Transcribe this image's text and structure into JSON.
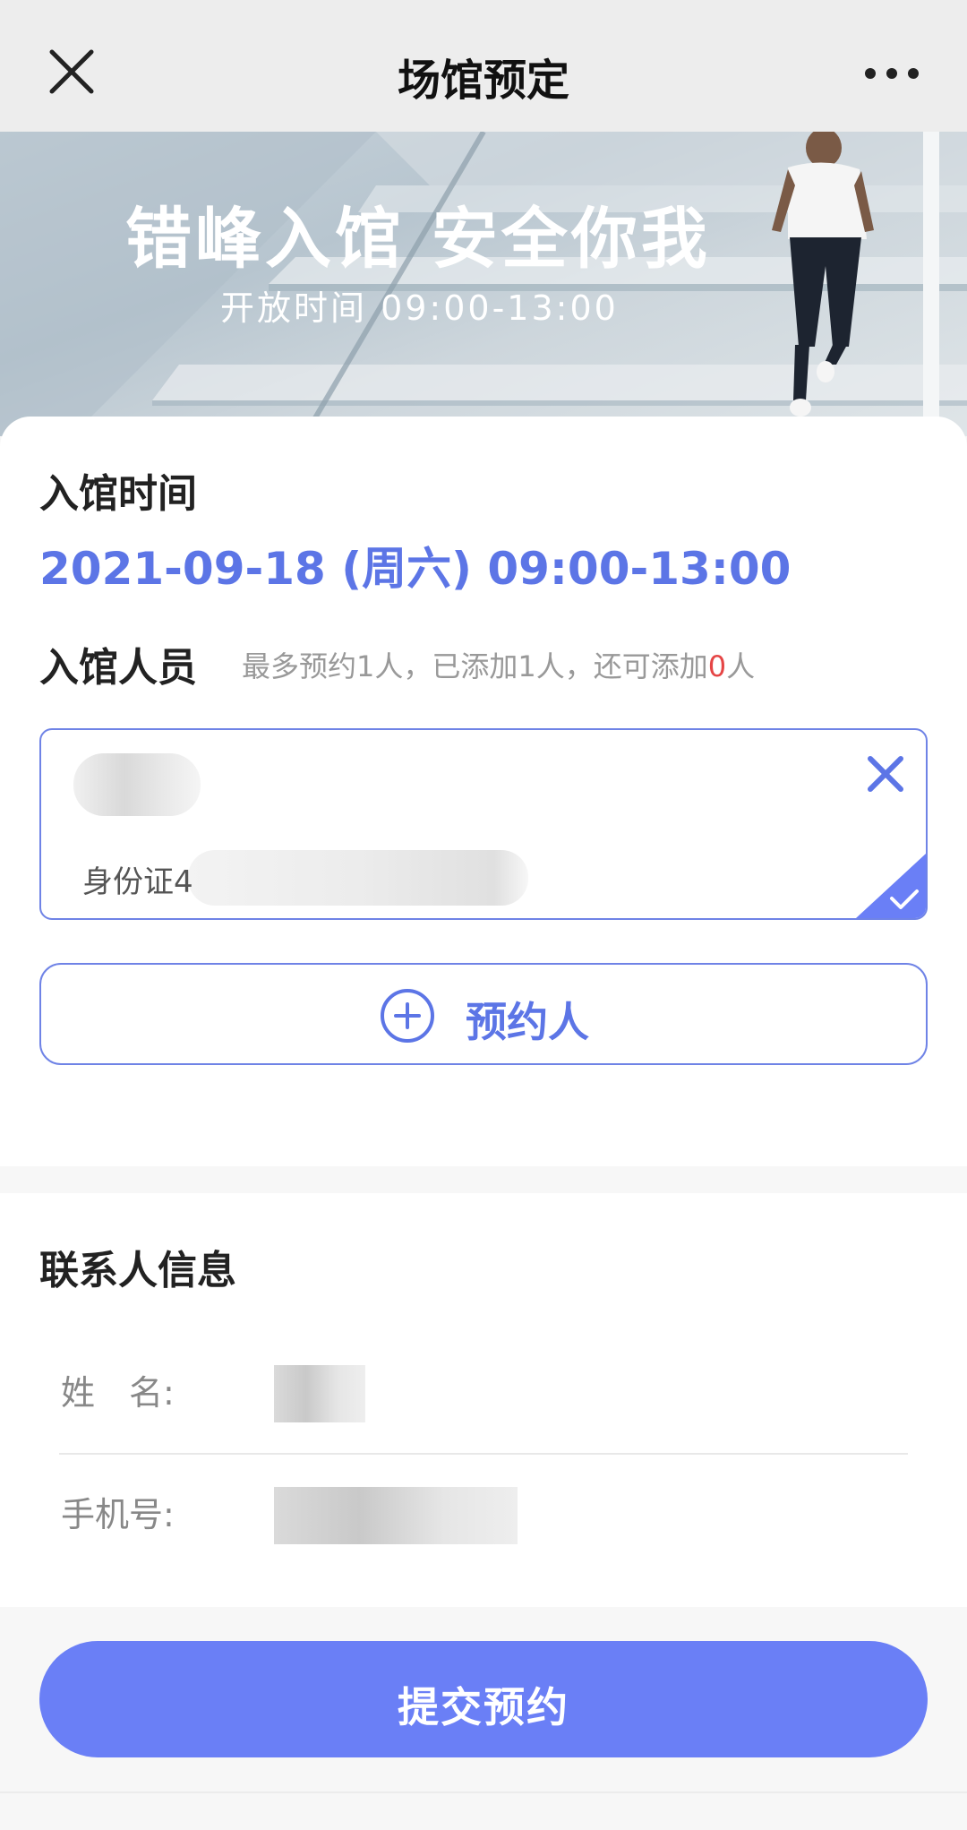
{
  "navbar": {
    "title": "场馆预定",
    "close_icon": "close-icon",
    "more_icon": "more-icon"
  },
  "banner": {
    "title": "错峰入馆 安全你我",
    "subtitle": "开放时间 09:00-13:00"
  },
  "entry": {
    "time_label": "入馆时间",
    "datetime": "2021-09-18 (周六) 09:00-13:00",
    "people_label": "入馆人员",
    "hint_prefix": "最多预约1人，已添加1人，还可添加",
    "hint_count": "0",
    "hint_suffix": "人",
    "person": {
      "id_label": "身份证4",
      "selected": true
    },
    "add_button_label": "预约人"
  },
  "contact": {
    "title": "联系人信息",
    "name_label": "姓　名:",
    "phone_label": "手机号:"
  },
  "footer": {
    "submit_label": "提交预约"
  },
  "colors": {
    "accent": "#5c75e6",
    "button": "#6a7ff6",
    "hint_red": "#e54545"
  }
}
